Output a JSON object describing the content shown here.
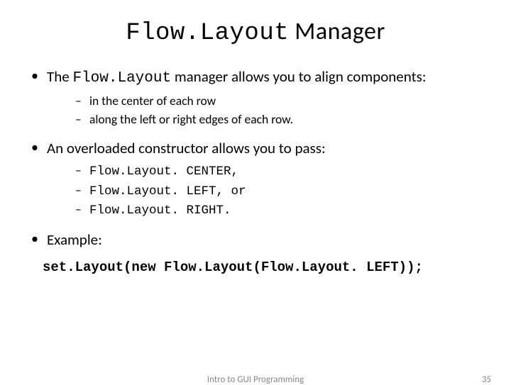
{
  "title": {
    "code": "Flow.Layout",
    "rest": " Manager"
  },
  "bullets": [
    {
      "pre": "The ",
      "code": "Flow.Layout",
      "post": " manager allows you to align components:",
      "sub": [
        {
          "text": "in the center of each row"
        },
        {
          "text": "along the left or right edges of each row."
        }
      ]
    },
    {
      "pre": "An overloaded constructor allows you to pass:",
      "code": "",
      "post": "",
      "sub": [
        {
          "code": "Flow.Layout. CENTER,"
        },
        {
          "code": "Flow.Layout. LEFT, or"
        },
        {
          "code": "Flow.Layout. RIGHT."
        }
      ]
    },
    {
      "pre": "Example:",
      "code": "",
      "post": "",
      "sub": []
    }
  ],
  "example_code": "set.Layout(new Flow.Layout(Flow.Layout. LEFT));",
  "footer": {
    "center": "Intro to GUI Programming",
    "page": "35"
  }
}
